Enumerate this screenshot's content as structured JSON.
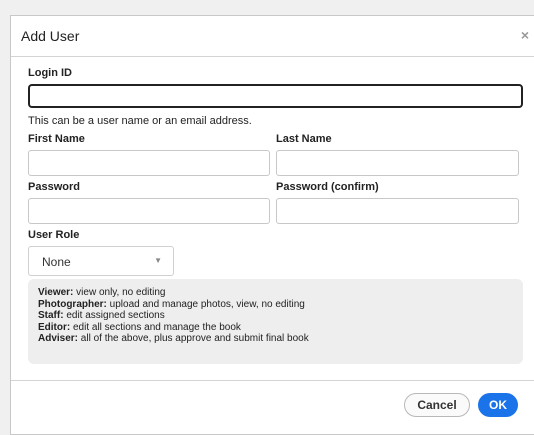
{
  "dialog": {
    "title": "Add User",
    "close_glyph": "×"
  },
  "form": {
    "login_id": {
      "label": "Login ID",
      "value": "",
      "hint": "This can be a user name or an email address."
    },
    "first_name": {
      "label": "First Name",
      "value": ""
    },
    "last_name": {
      "label": "Last Name",
      "value": ""
    },
    "password": {
      "label": "Password",
      "value": ""
    },
    "password_confirm": {
      "label": "Password (confirm)",
      "value": ""
    },
    "user_role": {
      "label": "User Role",
      "selected": "None"
    }
  },
  "roles": [
    {
      "name": "Viewer:",
      "desc": " view only, no editing"
    },
    {
      "name": "Photographer:",
      "desc": " upload and manage photos, view, no editing"
    },
    {
      "name": "Staff:",
      "desc": " edit assigned sections"
    },
    {
      "name": "Editor:",
      "desc": " edit all sections and manage the book"
    },
    {
      "name": "Adviser:",
      "desc": " all of the above, plus approve and submit final book"
    }
  ],
  "buttons": {
    "cancel": "Cancel",
    "ok": "OK"
  },
  "colors": {
    "primary": "#1a73e8",
    "role_box_bg": "#eeeeee"
  }
}
